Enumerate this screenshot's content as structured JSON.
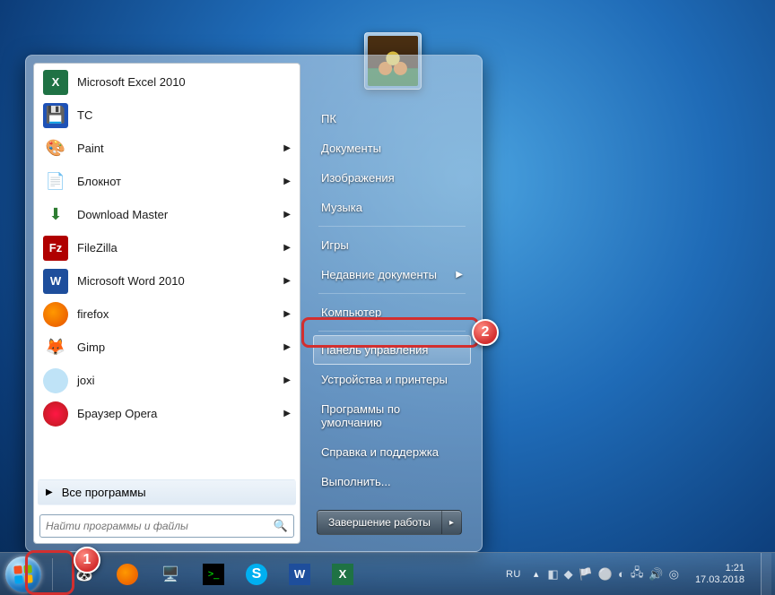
{
  "start_menu": {
    "programs": [
      {
        "label": "Microsoft Excel 2010",
        "icon": "excel-icon",
        "has_submenu": false
      },
      {
        "label": "TC",
        "icon": "tc-icon",
        "has_submenu": false
      },
      {
        "label": "Paint",
        "icon": "paint-icon",
        "has_submenu": true
      },
      {
        "label": "Блокнот",
        "icon": "notepad-icon",
        "has_submenu": true
      },
      {
        "label": "Download Master",
        "icon": "dm-icon",
        "has_submenu": true
      },
      {
        "label": "FileZilla",
        "icon": "filezilla-icon",
        "has_submenu": true
      },
      {
        "label": "Microsoft Word 2010",
        "icon": "word-icon",
        "has_submenu": true
      },
      {
        "label": "firefox",
        "icon": "firefox-icon",
        "has_submenu": true
      },
      {
        "label": "Gimp",
        "icon": "gimp-icon",
        "has_submenu": true
      },
      {
        "label": "joxi",
        "icon": "joxi-icon",
        "has_submenu": true
      },
      {
        "label": "Браузер Opera",
        "icon": "opera-icon",
        "has_submenu": true
      }
    ],
    "all_programs_label": "Все программы",
    "search_placeholder": "Найти программы и файлы",
    "right_items": [
      {
        "label": "ПК",
        "sep_after": false
      },
      {
        "label": "Документы",
        "sep_after": false
      },
      {
        "label": "Изображения",
        "sep_after": false
      },
      {
        "label": "Музыка",
        "sep_after": true
      },
      {
        "label": "Игры",
        "sep_after": false
      },
      {
        "label": "Недавние документы",
        "has_submenu": true,
        "sep_after": true
      },
      {
        "label": "Компьютер",
        "sep_after": true
      },
      {
        "label": "Панель управления",
        "highlight": true,
        "sep_after": false
      },
      {
        "label": "Устройства и принтеры",
        "sep_after": false
      },
      {
        "label": "Программы по умолчанию",
        "sep_after": false
      },
      {
        "label": "Справка и поддержка",
        "sep_after": false
      },
      {
        "label": "Выполнить...",
        "sep_after": false
      }
    ],
    "shutdown_label": "Завершение работы"
  },
  "taskbar": {
    "lang": "RU",
    "time": "1:21",
    "date": "17.03.2018",
    "pinned": [
      "panda-icon",
      "firefox-icon",
      "system-icon",
      "cmd-icon",
      "skype-icon",
      "word-icon",
      "excel-icon"
    ]
  },
  "callouts": {
    "one": "1",
    "two": "2"
  }
}
